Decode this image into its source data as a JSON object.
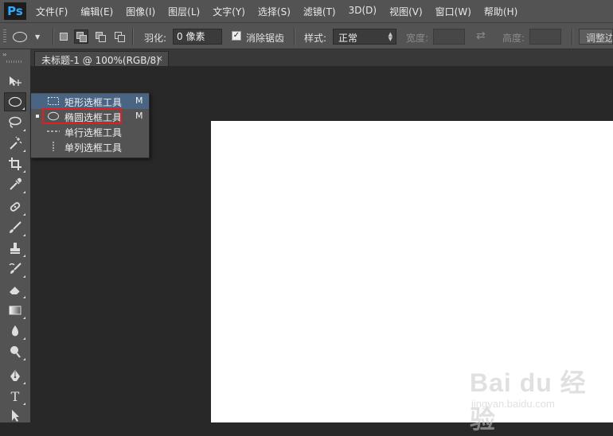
{
  "app": {
    "logo": "Ps"
  },
  "menu": [
    "文件(F)",
    "编辑(E)",
    "图像(I)",
    "图层(L)",
    "文字(Y)",
    "选择(S)",
    "滤镜(T)",
    "3D(D)",
    "视图(V)",
    "窗口(W)",
    "帮助(H)"
  ],
  "options": {
    "feather_label": "羽化:",
    "feather_value": "0 像素",
    "antialias_label": "消除锯齿",
    "antialias_checked": true,
    "style_label": "样式:",
    "style_value": "正常",
    "width_label": "宽度:",
    "height_label": "高度:",
    "adjust_edge": "调整边"
  },
  "document": {
    "tab_title": "未标题-1 @ 100%(RGB/8)",
    "close_glyph": "×",
    "canvas_color": "#ffffff"
  },
  "toolbar": {
    "collapse_glyph": "››",
    "tools": [
      "move-icon",
      "elliptical-marquee-icon",
      "lasso-icon",
      "magic-wand-icon",
      "crop-icon",
      "eyedropper-icon",
      "healing-brush-icon",
      "brush-icon",
      "clone-stamp-icon",
      "history-brush-icon",
      "eraser-icon",
      "gradient-icon",
      "blur-icon",
      "dodge-icon",
      "pen-icon",
      "type-icon",
      "path-selection-icon"
    ],
    "type_glyph": "T"
  },
  "flyout": {
    "items": [
      {
        "label": "矩形选框工具",
        "key": "M"
      },
      {
        "label": "椭圆选框工具",
        "key": "M"
      },
      {
        "label": "单行选框工具",
        "key": ""
      },
      {
        "label": "单列选框工具",
        "key": ""
      }
    ]
  },
  "watermark": {
    "logo": "Bai du 经验",
    "url": "jingyan.baidu.com"
  },
  "colors": {
    "menu_bg": "#535353",
    "workspace_bg": "#282828",
    "highlight": "#4a6584",
    "red_box": "#e02020",
    "ps_blue": "#31a8ff"
  }
}
